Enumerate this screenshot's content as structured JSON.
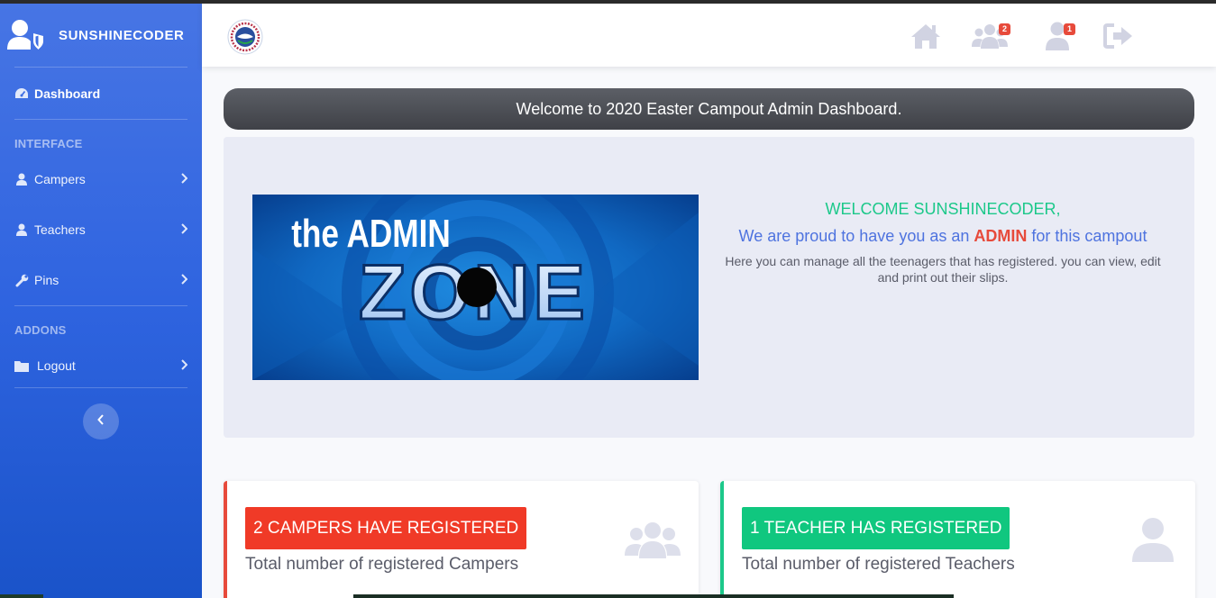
{
  "brand": {
    "name": "SUNSHINECODER",
    "icon": "user-shield-icon"
  },
  "sidebar": {
    "dashboard": {
      "label": "Dashboard",
      "icon": "tachometer-icon"
    },
    "sections": [
      {
        "title": "INTERFACE"
      },
      {
        "title": "ADDONS"
      }
    ],
    "items": [
      {
        "label": "Campers",
        "icon": "user-icon"
      },
      {
        "label": "Teachers",
        "icon": "user-icon"
      },
      {
        "label": "Pins",
        "icon": "wrench-icon"
      },
      {
        "label": "Logout",
        "icon": "folder-icon"
      }
    ],
    "toggle_icon": "chevron-left-icon"
  },
  "topbar": {
    "logo": "church-logo",
    "icons": [
      {
        "name": "home-icon"
      },
      {
        "name": "users-icon",
        "badge": "2"
      },
      {
        "name": "user-icon",
        "badge": "1"
      },
      {
        "name": "sign-out-icon"
      }
    ]
  },
  "welcome_banner": "Welcome to 2020 Easter Campout Admin Dashboard.",
  "hero": {
    "image_text_top": "the ADMIN",
    "image_text_bottom": "ZONE",
    "greeting": "WELCOME SUNSHINECODER,",
    "line_before": "We are proud to have you as an ",
    "line_highlight": "ADMIN",
    "line_after": " for this campout",
    "description": "Here you can manage all the teenagers that has registered. you can view, edit and print out their slips."
  },
  "cards": {
    "campers": {
      "title": "2 CAMPERS HAVE REGISTERED",
      "subtitle": "Total number of registered Campers",
      "icon": "users-icon"
    },
    "teachers": {
      "title": "1 TEACHER HAS REGISTERED",
      "subtitle": "Total number of registered Teachers",
      "icon": "user-icon"
    }
  },
  "colors": {
    "primary": "#4e73df",
    "danger": "#e74a3b",
    "success": "#1cc88a"
  }
}
